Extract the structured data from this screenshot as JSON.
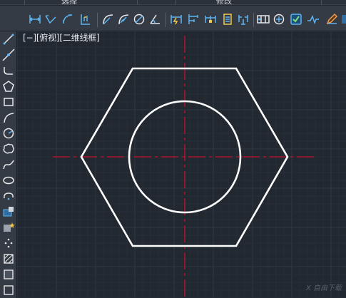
{
  "ribbon": {
    "tabs": [
      {
        "label": "选择"
      },
      {
        "label": "修改"
      }
    ]
  },
  "toolbar": {
    "icons": [
      "dimension-linear-icon",
      "dimension-aligned-icon",
      "dimension-arc-icon",
      "dimension-ordinate-icon",
      "dimension-radius-icon",
      "dimension-jogged-icon",
      "dimension-diameter-icon",
      "dimension-angular-icon",
      "quick-dimension-icon",
      "baseline-dimension-icon",
      "continue-dimension-icon",
      "dimension-space-icon",
      "dimension-break-icon",
      "tolerance-icon",
      "center-mark-icon",
      "inspection-icon",
      "jogged-linear-icon",
      "dimension-edit-icon"
    ]
  },
  "left_toolbar": {
    "icons": [
      "line-icon",
      "construction-line-icon",
      "polyline-icon",
      "polygon-icon",
      "rectangle-icon",
      "arc-icon",
      "circle-icon",
      "revision-cloud-icon",
      "spline-icon",
      "ellipse-icon",
      "ellipse-arc-icon",
      "insert-block-icon",
      "make-block-icon",
      "point-icon",
      "hatch-icon",
      "region-icon"
    ]
  },
  "viewport": {
    "label": "[−][俯视][二维线框]"
  },
  "watermark": {
    "text": "X 自由下载"
  },
  "colors": {
    "background": "#212830",
    "grid_major": "#2f3843",
    "grid_minor": "#262e37",
    "geometry": "#ffffff",
    "centerline": "#c8102e"
  }
}
